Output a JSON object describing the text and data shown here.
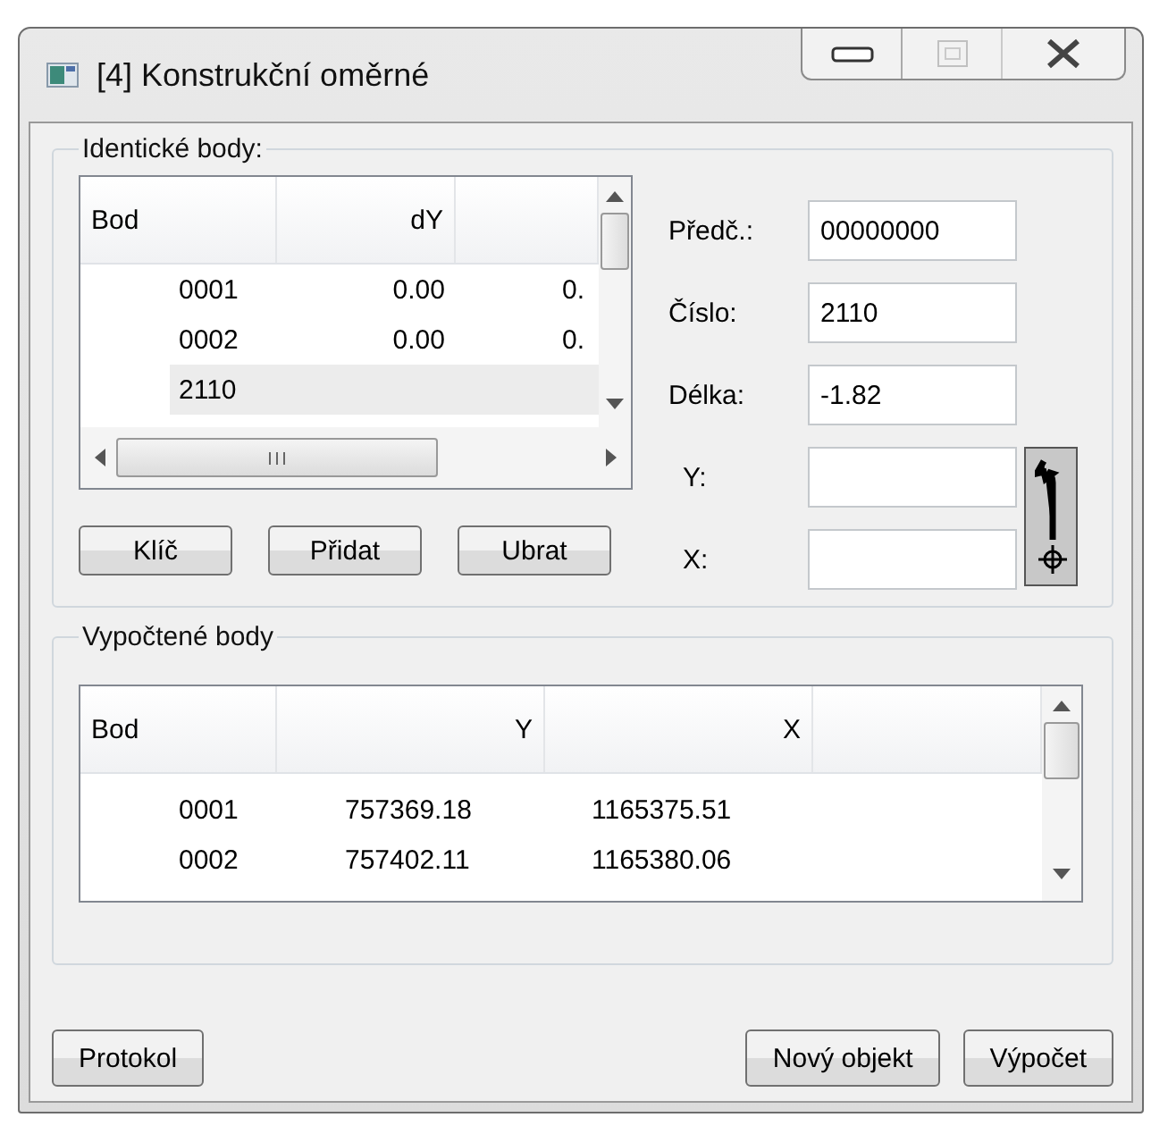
{
  "window": {
    "title": "[4] Konstrukční oměrné",
    "controls": [
      {
        "kind": "minimize",
        "disabled": false
      },
      {
        "kind": "maximize",
        "disabled": true
      },
      {
        "kind": "close",
        "disabled": false
      }
    ]
  },
  "identical_points": {
    "title": "Identické body:",
    "columns": [
      "Bod",
      "dY"
    ],
    "rows": [
      {
        "cells": [
          "0001",
          "0.00",
          "0."
        ],
        "selected": false
      },
      {
        "cells": [
          "0002",
          "0.00",
          "0."
        ],
        "selected": false
      },
      {
        "cells": [
          "2110"
        ],
        "selected": true
      }
    ],
    "buttons": [
      "Klíč",
      "Přidat",
      "Ubrat"
    ]
  },
  "fields": [
    {
      "label": "Předč.:",
      "value": "00000000"
    },
    {
      "label": "Číslo:",
      "value": "2110"
    },
    {
      "label": "Délka:",
      "value": "-1.82"
    },
    {
      "label": "Y:"
    },
    {
      "label": "X:"
    }
  ],
  "computed_points": {
    "title": "Vypočtené body",
    "columns": [
      "Bod",
      "Y",
      "X"
    ],
    "rows": [
      [
        "0001",
        "757369.18",
        "1165375.51"
      ],
      [
        "0002",
        "757402.11",
        "1165380.06"
      ]
    ]
  },
  "buttons": [
    {
      "label": "Protokol",
      "kind": "left"
    },
    {
      "label": "Nový objekt",
      "kind": "right"
    },
    {
      "label": "Výpočet",
      "kind": "right"
    }
  ]
}
